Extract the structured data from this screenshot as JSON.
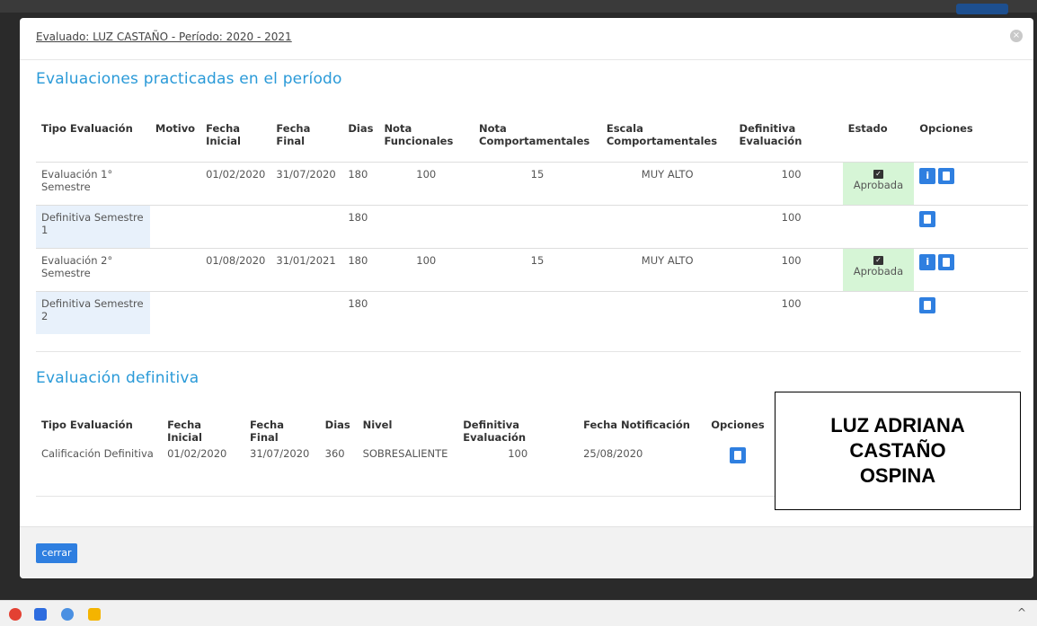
{
  "modal": {
    "title": "Evaluado: LUZ CASTAÑO - Período: 2020 - 2021"
  },
  "section1": {
    "title": "Evaluaciones practicadas en el período",
    "headers": [
      "Tipo Evaluación",
      "Motivo",
      "Fecha Inicial",
      "Fecha Final",
      "Dias",
      "Nota Funcionales",
      "Nota Comportamentales",
      "Escala Comportamentales",
      "Definitiva Evaluación",
      "Estado",
      "Opciones"
    ],
    "rows": [
      {
        "tipo": "Evaluación 1° Semestre",
        "motivo": "",
        "inicial": "01/02/2020",
        "final": "31/07/2020",
        "dias": "180",
        "funcionales": "100",
        "comportamentales": "15",
        "escala": "MUY ALTO",
        "definitiva": "100",
        "estado": "Aprobada"
      },
      {
        "tipo": "Definitiva Semestre 1",
        "motivo": "",
        "inicial": "",
        "final": "",
        "dias": "180",
        "funcionales": "",
        "comportamentales": "",
        "escala": "",
        "definitiva": "100",
        "estado": ""
      },
      {
        "tipo": "Evaluación 2° Semestre",
        "motivo": "",
        "inicial": "01/08/2020",
        "final": "31/01/2021",
        "dias": "180",
        "funcionales": "100",
        "comportamentales": "15",
        "escala": "MUY ALTO",
        "definitiva": "100",
        "estado": "Aprobada"
      },
      {
        "tipo": "Definitiva Semestre 2",
        "motivo": "",
        "inicial": "",
        "final": "",
        "dias": "180",
        "funcionales": "",
        "comportamentales": "",
        "escala": "",
        "definitiva": "100",
        "estado": ""
      }
    ]
  },
  "section2": {
    "title": "Evaluación definitiva",
    "headers": [
      "Tipo Evaluación",
      "Fecha Inicial",
      "Fecha Final",
      "Dias",
      "Nivel",
      "Definitiva Evaluación",
      "Fecha Notificación",
      "Opciones"
    ],
    "row": {
      "tipo": "Calificación Definitiva",
      "inicial": "01/02/2020",
      "final": "31/07/2020",
      "dias": "360",
      "nivel": "SOBRESALIENTE",
      "definitiva": "100",
      "notificacion": "25/08/2020"
    }
  },
  "overlay_box": {
    "line1": "LUZ ADRIANA",
    "line2": "CASTAÑO",
    "line3": "OSPINA"
  },
  "footer": {
    "close_label": "cerrar"
  },
  "icons": {
    "info": "i",
    "close": "×",
    "check": "✓",
    "caret_up": "^"
  },
  "colors": {
    "accent": "#2a9ad8",
    "button": "#2f7fe0",
    "approved_bg": "#d6f5d6"
  }
}
